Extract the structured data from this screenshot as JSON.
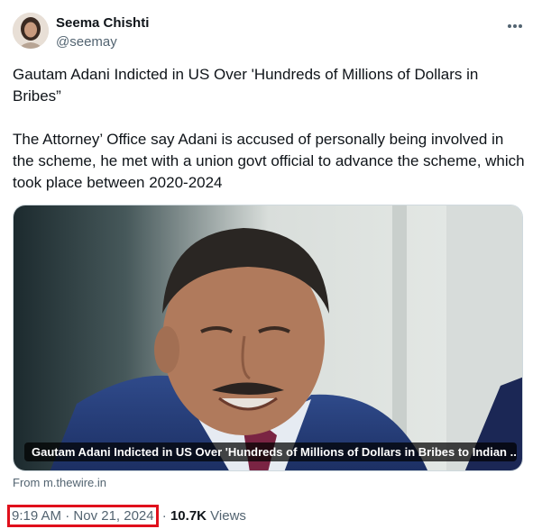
{
  "author": {
    "name": "Seema Chishti",
    "handle": "@seemay"
  },
  "tweet": {
    "paragraphs": [
      "Gautam Adani Indicted in US Over 'Hundreds of Millions of Dollars in Bribes”",
      "The Attorney’ Office say Adani is accused of personally being involved in the scheme, he met with a union govt official to advance the scheme, which took place between 2020-2024"
    ]
  },
  "card": {
    "caption": "Gautam Adani Indicted in US Over 'Hundreds of Millions of Dollars in Bribes to Indian ...",
    "source": "From m.thewire.in"
  },
  "meta": {
    "time": "9:19 AM",
    "separator": "·",
    "date": "Nov 21, 2024",
    "separator2": "·",
    "views_count": "10.7K",
    "views_label": "Views"
  },
  "colors": {
    "highlight_box": "#e0101c",
    "secondary_text": "#536471",
    "primary_text": "#0f1419"
  },
  "icons": {
    "more": "more-horizontal-icon",
    "avatar": "avatar"
  }
}
